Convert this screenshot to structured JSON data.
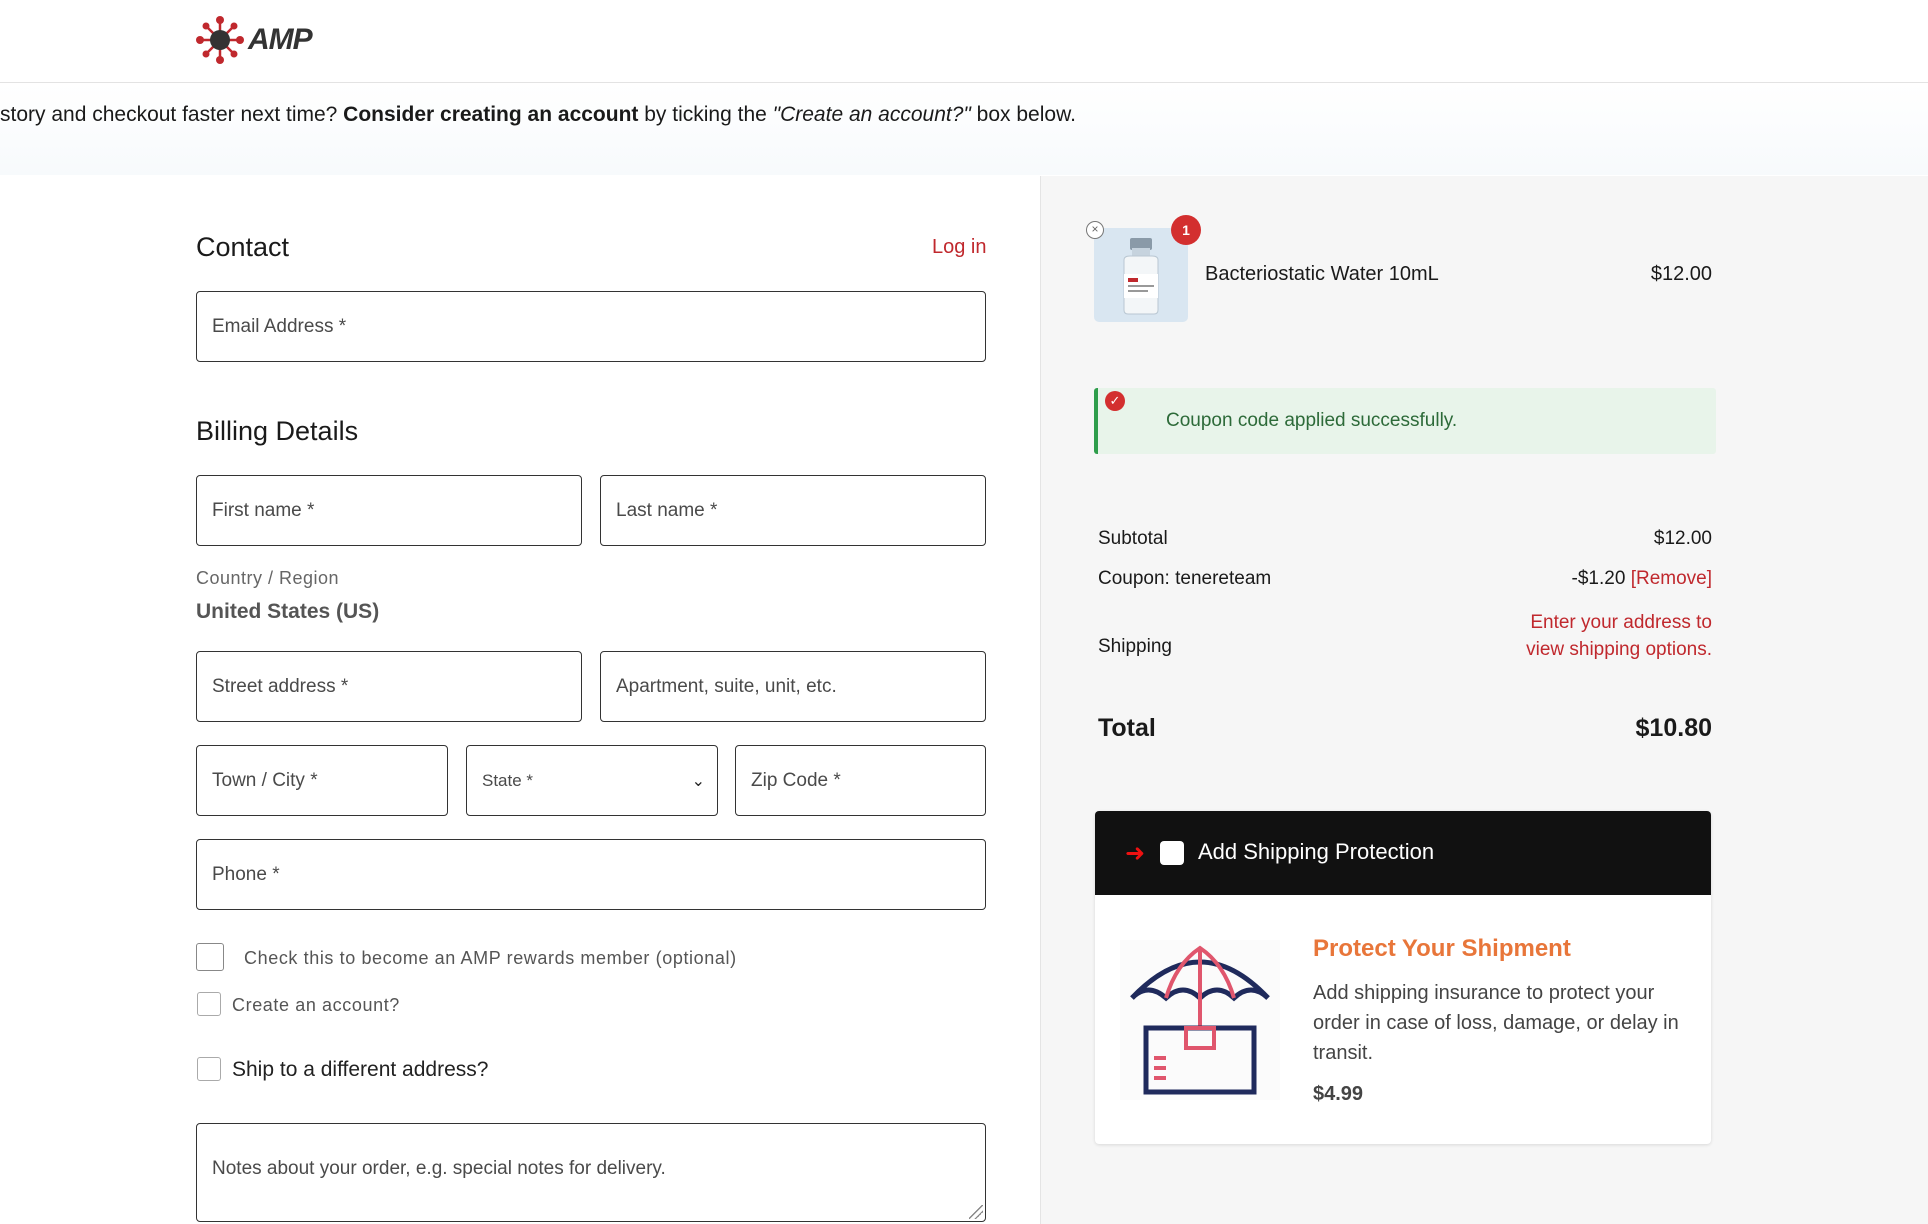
{
  "header": {
    "logo_text": "AMP"
  },
  "notice": {
    "part1": "story and checkout faster next time? ",
    "bold": "Consider creating an account",
    "part2": " by ticking the ",
    "italic": "\"Create an account?\"",
    "part3": " box below."
  },
  "contact": {
    "title": "Contact",
    "login_label": "Log in",
    "email_placeholder": "Email Address *"
  },
  "billing": {
    "title": "Billing Details",
    "first_name_placeholder": "First name *",
    "last_name_placeholder": "Last name *",
    "country_label": "Country / Region",
    "country_value": "United States (US)",
    "street_placeholder": "Street address *",
    "apartment_placeholder": "Apartment, suite, unit, etc.",
    "city_placeholder": "Town / City *",
    "state_placeholder": "State *",
    "zip_placeholder": "Zip Code *",
    "phone_placeholder": "Phone *",
    "rewards_label": "Check this to become an AMP rewards member (optional)",
    "create_account_label": "Create an account?",
    "ship_different_label": "Ship to a different address?",
    "notes_placeholder": "Notes about your order, e.g. special notes for delivery."
  },
  "order": {
    "item": {
      "name": "Bacteriostatic Water 10mL",
      "price": "$12.00",
      "quantity": "1"
    },
    "coupon_message": "Coupon code applied successfully.",
    "subtotal_label": "Subtotal",
    "subtotal_value": "$12.00",
    "coupon_label": "Coupon: tenereteam",
    "coupon_value": "-$1.20",
    "coupon_remove": "[Remove]",
    "shipping_label": "Shipping",
    "shipping_value": "Enter your address to view shipping options.",
    "total_label": "Total",
    "total_value": "$10.80"
  },
  "protection": {
    "header_label": "Add Shipping Protection",
    "title": "Protect Your Shipment",
    "description": "Add shipping insurance to protect your order in case of loss, damage, or delay in transit.",
    "price": "$4.99"
  },
  "colors": {
    "accent_red": "#c0282d",
    "success_green": "#2e9d4b",
    "protection_orange": "#e8763a"
  }
}
